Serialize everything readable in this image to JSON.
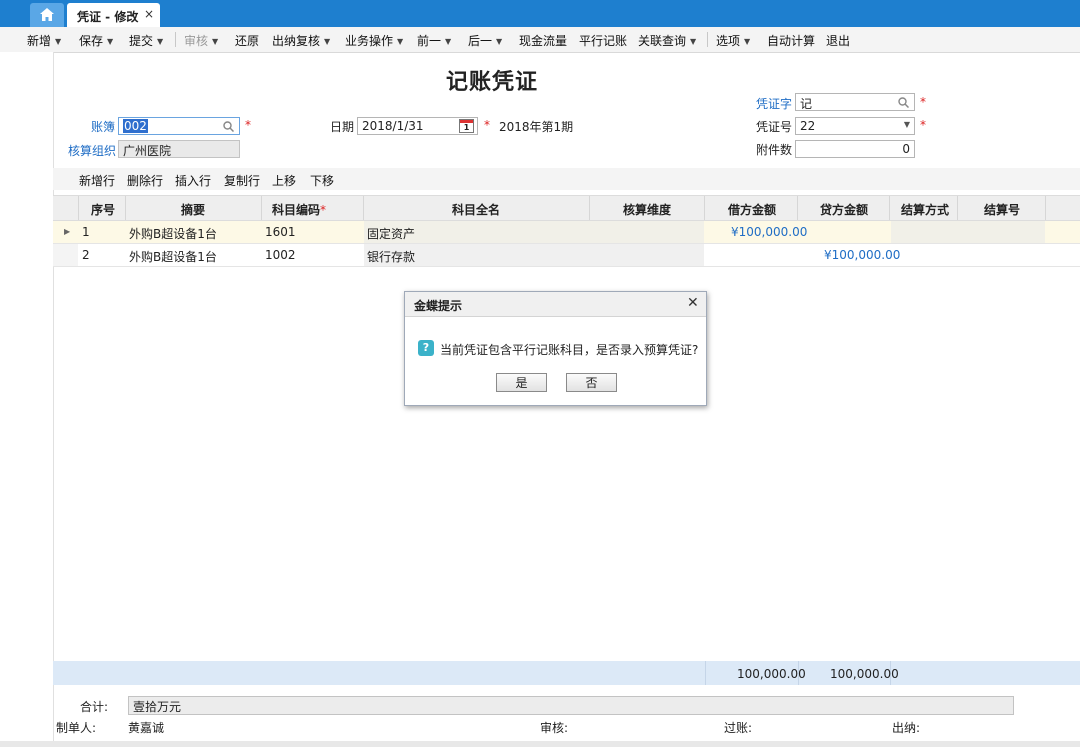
{
  "tabs": {
    "home_icon": "home-icon",
    "doc_tab": "凭证 - 修改",
    "close_glyph": "×"
  },
  "toolbar": {
    "items": [
      {
        "label": "新增",
        "arrow": true
      },
      {
        "label": "保存",
        "arrow": true
      },
      {
        "label": "提交",
        "arrow": true
      },
      {
        "label": "审核",
        "arrow": true,
        "disabled": true
      },
      {
        "label": "还原"
      },
      {
        "label": "出纳复核",
        "arrow": true
      },
      {
        "label": "业务操作",
        "arrow": true
      },
      {
        "label": "前一",
        "arrow": true
      },
      {
        "label": "后一",
        "arrow": true
      },
      {
        "label": "现金流量"
      },
      {
        "label": "平行记账"
      },
      {
        "label": "关联查询",
        "arrow": true
      },
      {
        "label": "选项",
        "arrow": true
      },
      {
        "label": "自动计算"
      },
      {
        "label": "退出"
      }
    ]
  },
  "form": {
    "title": "记账凭证",
    "book_label": "账簿",
    "book_value": "002",
    "org_label": "核算组织",
    "org_value": "广州医院",
    "date_label": "日期",
    "date_value": "2018/1/31",
    "calendar_day": "1",
    "period": "2018年第1期",
    "voucher_word_label": "凭证字",
    "voucher_word_value": "记",
    "voucher_no_label": "凭证号",
    "voucher_no_value": "22",
    "attach_label": "附件数",
    "attach_value": "0",
    "required_mark": "*"
  },
  "grid_toolbar": [
    "新增行",
    "删除行",
    "插入行",
    "复制行",
    "上移",
    "下移"
  ],
  "grid": {
    "headers": [
      "序号",
      "摘要",
      "科目编码",
      "科目全名",
      "核算维度",
      "借方金额",
      "贷方金额",
      "结算方式",
      "结算号"
    ],
    "rows": [
      {
        "no": "1",
        "summary": "外购B超设备1台",
        "code": "1601",
        "name": "固定资产",
        "debit": "¥100,000.00",
        "credit": ""
      },
      {
        "no": "2",
        "summary": "外购B超设备1台",
        "code": "1002",
        "name": "银行存款",
        "debit": "",
        "credit": "¥100,000.00"
      }
    ],
    "debit_total": "100,000.00",
    "credit_total": "100,000.00"
  },
  "footer": {
    "total_label": "合计:",
    "total_value": "壹拾万元",
    "maker_label": "制单人:",
    "maker_value": "黄嘉诚",
    "audit_label": "审核:",
    "post_label": "过账:",
    "cashier_label": "出纳:"
  },
  "dialog": {
    "title": "金蝶提示",
    "message": "当前凭证包含平行记账科目，是否录入预算凭证?",
    "icon_glyph": "?",
    "yes_label": "是",
    "no_label": "否"
  }
}
